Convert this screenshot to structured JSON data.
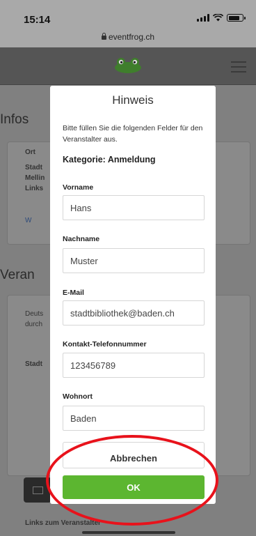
{
  "status_bar": {
    "time": "15:14",
    "url": "eventfrog.ch"
  },
  "background": {
    "section_infos": "Infos",
    "card1_text": [
      "Ort",
      "Stadt",
      "Mellin",
      "Links",
      "W"
    ],
    "section_veranstalter": "Veran",
    "card2_text": [
      "Deuts",
      "durch"
    ],
    "card2_bold": "Stadt",
    "footer_text": "Links zum Veranstalter"
  },
  "modal": {
    "title": "Hinweis",
    "intro": "Bitte füllen Sie die folgenden Felder für den Veranstalter aus.",
    "category": "Kategorie: Anmeldung",
    "fields": [
      {
        "label": "Vorname",
        "value": "Hans"
      },
      {
        "label": "Nachname",
        "value": "Muster"
      },
      {
        "label": "E-Mail",
        "value": "stadtbibliothek@baden.ch"
      },
      {
        "label": "Kontakt-Telefonnummer",
        "value": "123456789"
      },
      {
        "label": "Wohnort",
        "value": "Baden"
      }
    ],
    "cancel_label": "Abbrechen",
    "ok_label": "OK"
  },
  "colors": {
    "ok_button": "#5cb630",
    "annotation": "#e8121b",
    "overlay": "#808080"
  }
}
